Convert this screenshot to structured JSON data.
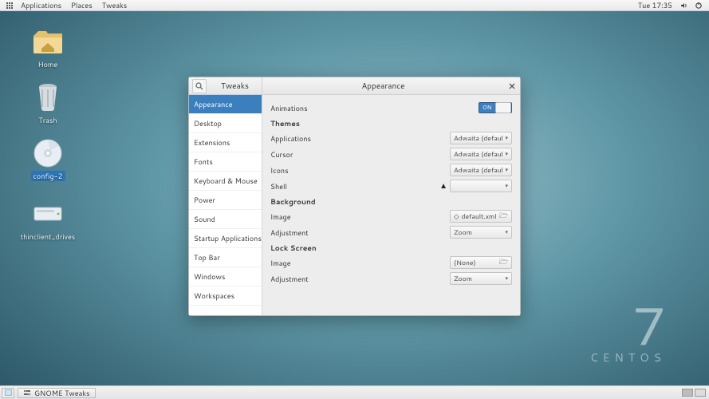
{
  "panel": {
    "menus": [
      "Applications",
      "Places",
      "Tweaks"
    ],
    "clock": "Tue 17:35",
    "tray": [
      "volume-icon",
      "power-icon"
    ]
  },
  "desktop_icons": [
    {
      "id": "home",
      "label": "Home"
    },
    {
      "id": "trash",
      "label": "Trash"
    },
    {
      "id": "config",
      "label": "config-2",
      "selected": true
    },
    {
      "id": "drives",
      "label": "thinclient_drives"
    }
  ],
  "brand": {
    "number": "7",
    "name": "CENTOS"
  },
  "window": {
    "app_title": "Tweaks",
    "page_title": "Appearance",
    "sidebar": {
      "items": [
        "Appearance",
        "Desktop",
        "Extensions",
        "Fonts",
        "Keyboard & Mouse",
        "Power",
        "Sound",
        "Startup Applications",
        "Top Bar",
        "Windows",
        "Workspaces"
      ],
      "active_index": 0
    },
    "content": {
      "animations_label": "Animations",
      "animations_state": "ON",
      "themes_header": "Themes",
      "applications_label": "Applications",
      "applications_value": "Adwaita (default)",
      "cursor_label": "Cursor",
      "cursor_value": "Adwaita (default)",
      "icons_label": "Icons",
      "icons_value": "Adwaita (default)",
      "shell_label": "Shell",
      "shell_value": "",
      "shell_warning": true,
      "background_header": "Background",
      "bg_image_label": "Image",
      "bg_image_value": "default.xml",
      "bg_adjust_label": "Adjustment",
      "bg_adjust_value": "Zoom",
      "lock_header": "Lock Screen",
      "ls_image_label": "Image",
      "ls_image_value": "(None)",
      "ls_adjust_label": "Adjustment",
      "ls_adjust_value": "Zoom"
    }
  },
  "taskbar": {
    "active_task": "GNOME Tweaks",
    "workspaces": 2,
    "active_workspace": 0
  }
}
